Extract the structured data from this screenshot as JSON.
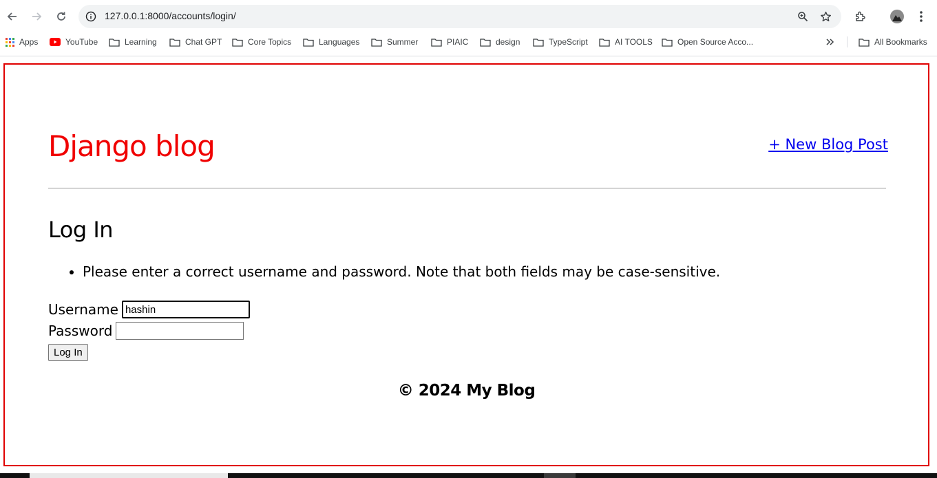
{
  "browser": {
    "url": "127.0.0.1:8000/accounts/login/",
    "bookmarks": [
      {
        "label": "Apps",
        "icon": "apps-grid-icon"
      },
      {
        "label": "YouTube",
        "icon": "youtube-icon"
      },
      {
        "label": "Learning",
        "icon": "folder-icon"
      },
      {
        "label": "Chat GPT",
        "icon": "folder-icon"
      },
      {
        "label": "Core Topics",
        "icon": "folder-icon"
      },
      {
        "label": "Languages",
        "icon": "folder-icon"
      },
      {
        "label": "Summer",
        "icon": "folder-icon"
      },
      {
        "label": "PIAIC",
        "icon": "folder-icon"
      },
      {
        "label": "design",
        "icon": "folder-icon"
      },
      {
        "label": "TypeScript",
        "icon": "folder-icon"
      },
      {
        "label": "AI TOOLS",
        "icon": "folder-icon"
      },
      {
        "label": "Open Source Acco..."
      }
    ],
    "all_bookmarks": "All Bookmarks"
  },
  "site": {
    "title": "Django blog",
    "new_post_link": "+ New Blog Post"
  },
  "login": {
    "heading": "Log In",
    "errors": [
      "Please enter a correct username and password. Note that both fields may be case-sensitive."
    ],
    "username_label": "Username",
    "username_value": "hashin",
    "password_label": "Password",
    "password_value": "",
    "submit_label": "Log In"
  },
  "footer": {
    "text": "© 2024 My Blog"
  },
  "colors": {
    "title_red": "#f00000",
    "frame_border": "#e00000",
    "link_blue": "#0000ee"
  }
}
